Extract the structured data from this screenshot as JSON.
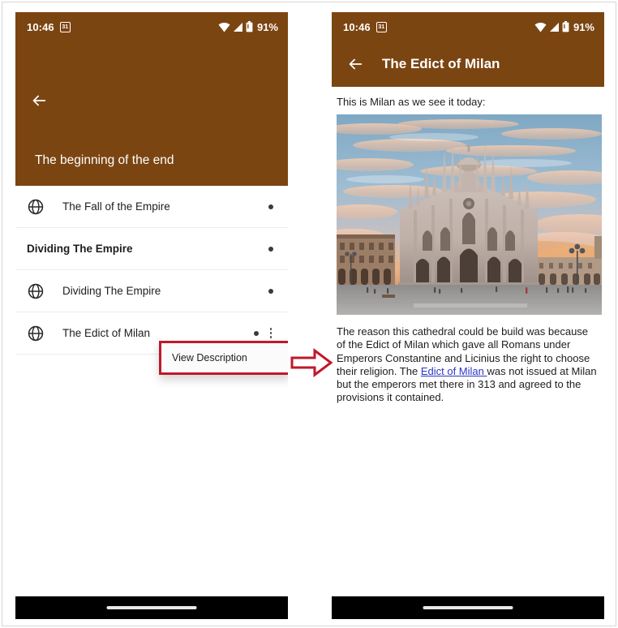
{
  "status_bar": {
    "time": "10:46",
    "calendar_icon_label": "31",
    "battery_percent": "91%",
    "icons": [
      "calendar-31-icon",
      "wifi-icon",
      "signal-icon",
      "battery-icon"
    ]
  },
  "colors": {
    "brand_brown": "#7B4512",
    "annotation_red": "#C0182B",
    "link_blue": "#2b35c4",
    "nav_bar_black": "#000000"
  },
  "left_panel": {
    "back_icon": "back-arrow-icon",
    "hero_title": "The beginning of the end",
    "list_items": [
      {
        "label": "The Fall of the Empire",
        "icon": "globe-icon",
        "is_header": false,
        "has_overflow": false
      },
      {
        "label": "Dividing The Empire",
        "icon": "",
        "is_header": true,
        "has_overflow": false
      },
      {
        "label": "Dividing The Empire",
        "icon": "globe-icon",
        "is_header": false,
        "has_overflow": false
      },
      {
        "label": "The Edict of Milan",
        "icon": "globe-icon",
        "is_header": false,
        "has_overflow": true
      }
    ],
    "popup_menu": {
      "item_label": "View Description"
    }
  },
  "right_panel": {
    "back_icon": "back-arrow-icon",
    "title": "The Edict of Milan",
    "intro_text": "This is Milan as we see it today:",
    "image_alt": "milan-duomo-cathedral-photo",
    "body": {
      "part1": "The reason this cathedral could be build was because of the Edict of Milan which gave all Romans under Emperors Constantine and Licinius the right to choose their religion. The ",
      "link": "Edict of Milan ",
      "part2": "was not issued at Milan but the emperors met there in 313 and agreed to the provisions it contained."
    }
  },
  "annotation": {
    "arrow_icon": "right-arrow-annotation"
  }
}
